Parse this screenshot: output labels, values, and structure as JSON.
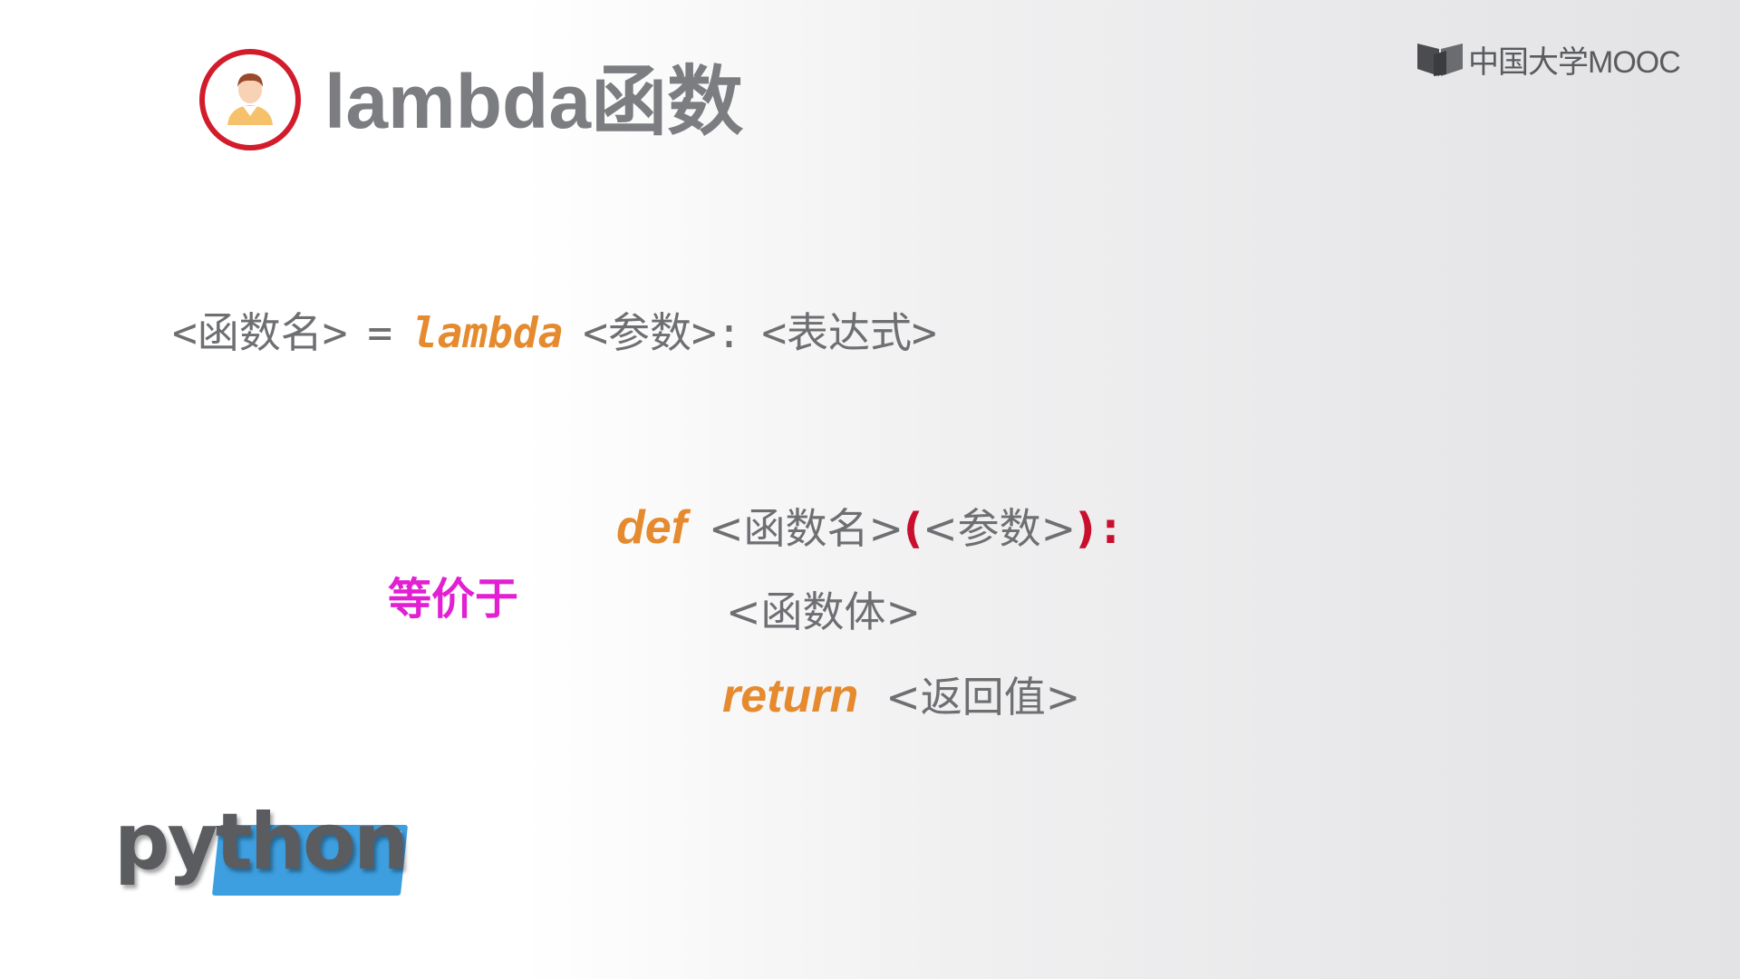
{
  "slide": {
    "title": "lambda函数",
    "logo_text": "中国大学MOOC",
    "syntax": {
      "lhs": "<函数名>",
      "eq": "=",
      "keyword": "lambda",
      "params": "<参数>:",
      "expr": "<表达式>"
    },
    "equivalent_label": "等价于",
    "def_block": {
      "def_kw": "def",
      "func_name": "<函数名>",
      "open_paren": "(",
      "params": "<参数>",
      "close_paren": ")",
      "colon": ":",
      "body": "<函数体>",
      "return_kw": "return",
      "return_value": "<返回值>"
    },
    "python_logo_text": "python"
  },
  "icons": {
    "avatar": "user-avatar-icon",
    "logo": "book-icon"
  },
  "colors": {
    "text_grey": "#6e6f72",
    "keyword_orange": "#e58a2e",
    "paren_red": "#c8102e",
    "equivalent_magenta": "#e21fd2",
    "avatar_ring_red": "#d21c2c",
    "python_blue": "#3d9fe0"
  }
}
